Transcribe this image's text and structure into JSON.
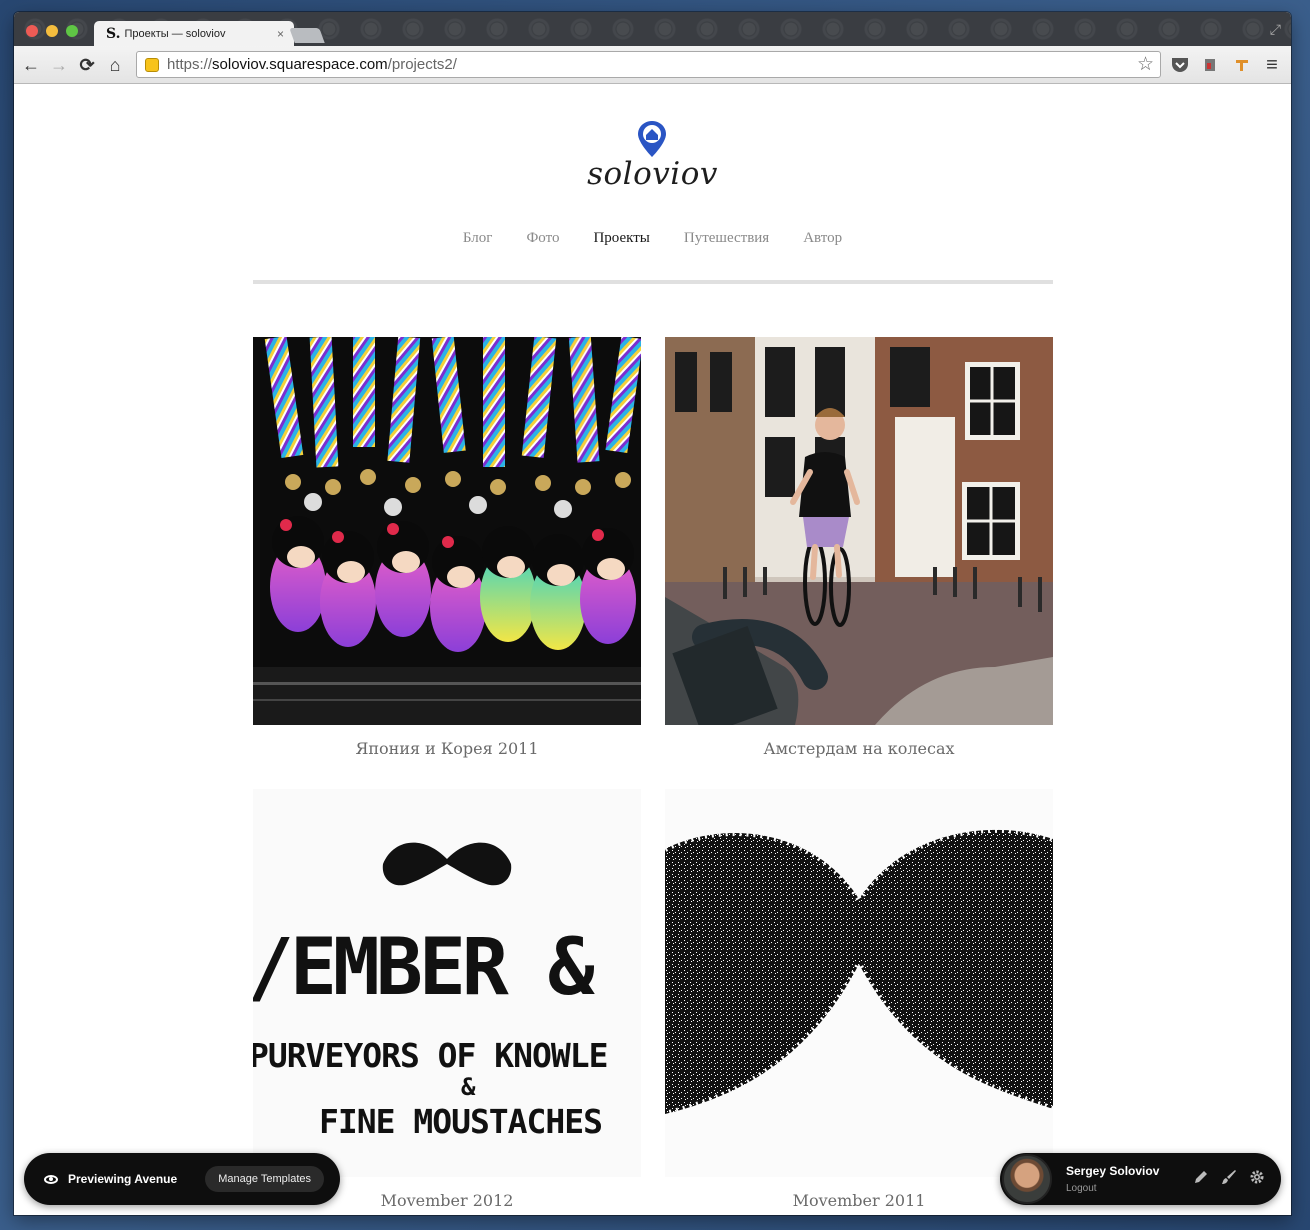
{
  "browser": {
    "tab": {
      "favicon": "S.",
      "title": "Проекты — soloviov",
      "close": "×"
    },
    "address": {
      "scheme": "https://",
      "host": "soloviov.squarespace.com",
      "path": "/projects2/"
    },
    "icons": {
      "back": "←",
      "forward": "→",
      "reload": "⟳",
      "home": "⌂",
      "star": "☆",
      "menu": "≡",
      "resize": "⤢"
    }
  },
  "site": {
    "title": "soloviov",
    "accent": "#2a55c4",
    "nav": [
      {
        "label": "Блог",
        "active": false
      },
      {
        "label": "Фото",
        "active": false
      },
      {
        "label": "Проекты",
        "active": true
      },
      {
        "label": "Путешествия",
        "active": false
      },
      {
        "label": "Автор",
        "active": false
      }
    ]
  },
  "projects": [
    {
      "caption": "Япония и Корея 2011"
    },
    {
      "caption": "Амстердам на колесах"
    },
    {
      "caption": "Movember 2012",
      "img_text_1": "/EMBER &",
      "img_text_2": "PURVEYORS OF KNOWLE",
      "img_text_3": "&",
      "img_text_4": "FINE MOUSTACHES"
    },
    {
      "caption": "Movember 2011"
    }
  ],
  "preview_bar": {
    "label": "Previewing Avenue",
    "button": "Manage Templates"
  },
  "user_bar": {
    "name": "Sergey Soloviov",
    "logout": "Logout"
  }
}
